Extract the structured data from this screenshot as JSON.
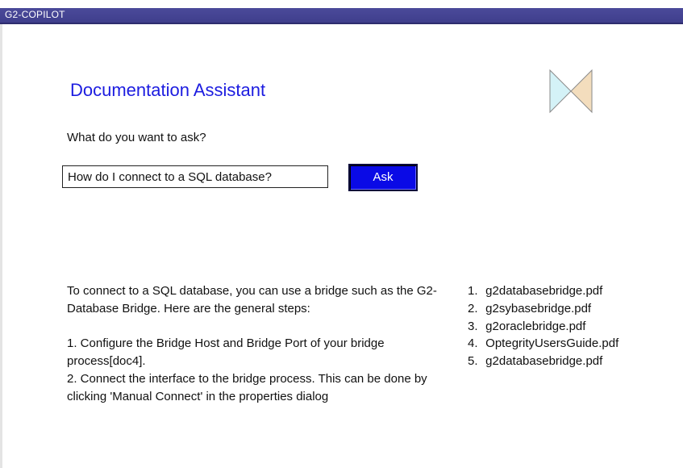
{
  "window": {
    "title": "G2-COPILOT"
  },
  "assistant": {
    "title": "Documentation Assistant",
    "logo_icon": "bowtie-logo-icon",
    "logo_colors": {
      "left": "#d4f2f7",
      "right": "#f3ddbd",
      "stroke": "#8a8a8a"
    }
  },
  "question": {
    "label": "What do you want to ask?",
    "value": "How do I connect to a SQL database?"
  },
  "ask_button": {
    "label": "Ask",
    "color": "#0a0ae6"
  },
  "answer": {
    "paragraphs": [
      "To connect to a SQL database, you can use a bridge such as the G2-Database Bridge. Here are the general steps:",
      "",
      "1. Configure the Bridge Host and Bridge Port of your bridge process[doc4].",
      "2. Connect the interface to the bridge process. This can be done by clicking 'Manual Connect' in the properties dialog"
    ]
  },
  "sources": [
    {
      "number": "1.",
      "file": "g2databasebridge.pdf"
    },
    {
      "number": "2.",
      "file": "g2sybasebridge.pdf"
    },
    {
      "number": "3.",
      "file": "g2oraclebridge.pdf"
    },
    {
      "number": "4.",
      "file": "OptegrityUsersGuide.pdf"
    },
    {
      "number": "5.",
      "file": "g2databasebridge.pdf"
    }
  ]
}
